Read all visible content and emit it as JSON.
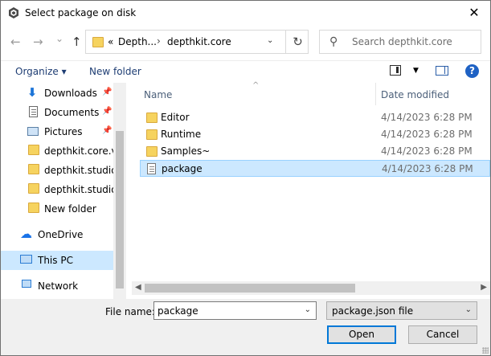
{
  "window": {
    "title": "Select package on disk",
    "close_glyph": "✕"
  },
  "nav": {
    "back_glyph": "←",
    "forward_glyph": "→",
    "recent_glyph": "⌄",
    "up_glyph": "↑",
    "address": {
      "prefix": "«",
      "crumbs": [
        "Depth...",
        "depthkit.core"
      ],
      "separator": "›"
    },
    "refresh_glyph": "↻",
    "search": {
      "placeholder": "Search depthkit.core",
      "icon_glyph": "⚲"
    }
  },
  "command_bar": {
    "organize_label": "Organize ▾",
    "new_folder_label": "New folder",
    "view_drop_glyph": "▼",
    "help_label": "?"
  },
  "nav_pane": {
    "items": [
      {
        "label": "Downloads",
        "icon": "download-icon",
        "pinned": true
      },
      {
        "label": "Documents",
        "icon": "documents-icon",
        "pinned": true
      },
      {
        "label": "Pictures",
        "icon": "pictures-icon",
        "pinned": true
      },
      {
        "label": "depthkit.core.vfx",
        "icon": "folder-icon",
        "pinned": false
      },
      {
        "label": "depthkit.studio",
        "icon": "folder-icon",
        "pinned": false
      },
      {
        "label": "depthkit.studio.vfx",
        "icon": "folder-icon",
        "pinned": false
      },
      {
        "label": "New folder",
        "icon": "folder-icon",
        "pinned": false
      },
      {
        "label": "OneDrive",
        "icon": "onedrive-icon",
        "pinned": false
      },
      {
        "label": "This PC",
        "icon": "this-pc-icon",
        "pinned": false,
        "selected": true
      },
      {
        "label": "Network",
        "icon": "network-icon",
        "pinned": false
      }
    ],
    "pin_glyph": "📌"
  },
  "file_list": {
    "columns": {
      "name": "Name",
      "date": "Date modified"
    },
    "sort_glyph": "^",
    "rows": [
      {
        "name": "Editor",
        "date": "4/14/2023 6:28 PM",
        "type": "folder"
      },
      {
        "name": "Runtime",
        "date": "4/14/2023 6:28 PM",
        "type": "folder"
      },
      {
        "name": "Samples~",
        "date": "4/14/2023 6:28 PM",
        "type": "folder"
      },
      {
        "name": "package",
        "date": "4/14/2023 6:28 PM",
        "type": "json-file",
        "selected": true
      }
    ],
    "scroll_left_glyph": "◀",
    "scroll_right_glyph": "▶"
  },
  "bottom": {
    "file_name_label": "File name:",
    "file_name_value": "package",
    "file_type_value": "package.json file",
    "dropdown_glyph": "⌄",
    "open_label": "Open",
    "cancel_label": "Cancel"
  },
  "colors": {
    "selection": "#cce8ff",
    "accent": "#0078d7",
    "folder": "#f6d35f",
    "link_text": "#1e3d73"
  }
}
